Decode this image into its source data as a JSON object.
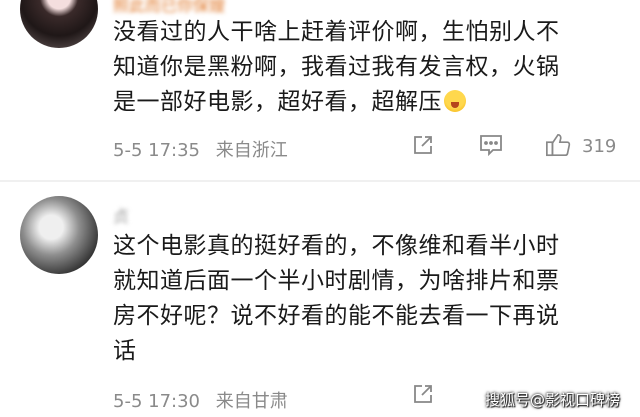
{
  "comments": [
    {
      "username": "照此而已你保嫂",
      "content": "没看过的人干啥上赶着评价啊，生怕别人不\n知道你是黑粉啊，我看过我有发言权，火锅\n是一部好电影，超好看，超解压",
      "emoji": "laughing-sweat-emoji",
      "date": "5-5 17:35",
      "location": "来自浙江",
      "likes": "319"
    },
    {
      "username": "贞",
      "content": "这个电影真的挺好看的，不像维和看半小时\n就知道后面一个半小时剧情，为啥排片和票\n房不好呢？说不好看的能不能去看一下再说\n话",
      "date": "5-5 17:30",
      "location": "来自甘肃"
    }
  ],
  "icons": {
    "share": "share-icon",
    "comment": "comment-icon",
    "like": "thumbs-up-icon"
  },
  "watermark": "搜狐号@影视口碑榜"
}
